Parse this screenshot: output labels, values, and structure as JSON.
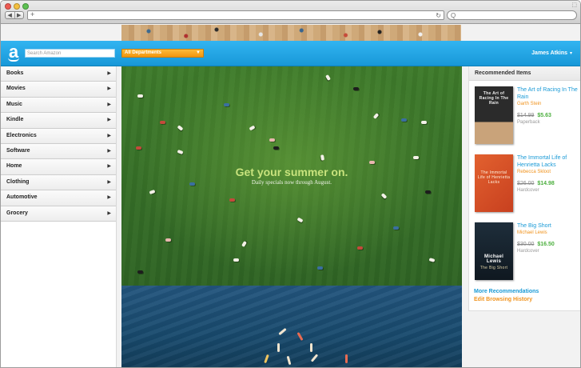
{
  "browser": {
    "traffic_colors": [
      "#ee5b53",
      "#f4bf3f",
      "#5cc151"
    ],
    "back_glyph": "◀",
    "forward_glyph": "▶",
    "url_plus": "+",
    "reload_glyph": "↻",
    "search_glyph": "Q"
  },
  "header": {
    "logo": "a",
    "search_placeholder": "Search Amazon",
    "department": "All Departments",
    "user": "James Atkins",
    "colors": {
      "bar": "#1ea6e6",
      "dept": "#f5a623"
    }
  },
  "sidebar": {
    "items": [
      {
        "label": "Books"
      },
      {
        "label": "Movies"
      },
      {
        "label": "Music"
      },
      {
        "label": "Kindle"
      },
      {
        "label": "Electronics"
      },
      {
        "label": "Software"
      },
      {
        "label": "Home"
      },
      {
        "label": "Clothing"
      },
      {
        "label": "Automotive"
      },
      {
        "label": "Grocery"
      }
    ]
  },
  "hero": {
    "headline": "Get your summer on.",
    "subline": "Daily specials now through August."
  },
  "recommended": {
    "title": "Recommended Items",
    "items": [
      {
        "title": "The Art of Racing In The Rain",
        "author": "Garth Stein",
        "old_price": "$14.99",
        "new_price": "$5.63",
        "format": "Paperback"
      },
      {
        "title": "The Immortal Life of Henrietta Lacks",
        "author": "Rebecca Skloot",
        "old_price": "$26.00",
        "new_price": "$14.98",
        "format": "Hardcover"
      },
      {
        "title": "The Big Short",
        "author": "Michael Lewis",
        "old_price": "$30.00",
        "new_price": "$16.50",
        "format": "Hardcover"
      }
    ],
    "more_link": "More Recommendations",
    "edit_link": "Edit Browsing History"
  }
}
